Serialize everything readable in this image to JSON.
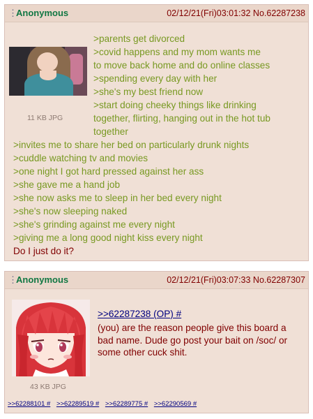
{
  "post1": {
    "name": "Anonymous",
    "datetime": "02/12/21(Fri)03:01:32",
    "number": "No.62287238",
    "file_info": "11 KB JPG",
    "lines": [
      ">parents get divorced",
      ">covid happens and my mom wants me",
      "to move back home and do online classes",
      ">spending every day with her",
      ">she's my best friend now",
      ">start doing cheeky things like drinking",
      "together, flirting, hanging out in the hot tub",
      "together",
      ">invites me to share her bed on particularly drunk nights",
      ">cuddle watching tv and movies",
      ">one night I got hard pressed against her ass",
      ">she gave me a hand job",
      ">she now asks me to sleep in her bed every night",
      ">she's now sleeping naked",
      ">she's grinding against me every night",
      ">giving me a long good night kiss every night"
    ],
    "question": "Do I just do it?"
  },
  "post2": {
    "name": "Anonymous",
    "datetime": "02/12/21(Fri)03:07:33",
    "number": "No.62287307",
    "file_info": "43 KB JPG",
    "quote_link": ">>62287238 (OP) #",
    "body": "(you) are the reason people give this board a bad name. Dude go post your bait on /soc/ or some other cuck shit.",
    "backlinks": [
      ">>62288101 #",
      ">>62289519 #",
      ">>62289775 #",
      ">>62290569 #"
    ]
  },
  "colors": {
    "post_bg": "#f0e0d6",
    "name_green": "#117743",
    "greentext": "#789922",
    "text_maroon": "#800000",
    "link_blue": "#000080"
  }
}
